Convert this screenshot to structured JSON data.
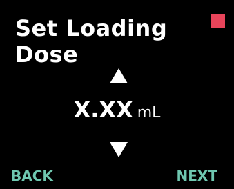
{
  "screen": {
    "title_line1": "Set Loading",
    "title_line2": "Dose",
    "value": "X.XX",
    "unit": "mL",
    "back_label": "BACK",
    "next_label": "NEXT",
    "icons": {
      "increase": "triangle-up-icon",
      "decrease": "triangle-down-icon",
      "status": "status-indicator-square"
    }
  },
  "colors": {
    "background": "#000000",
    "text": "#ffffff",
    "softkey": "#6fc7b0",
    "status_indicator": "#e8445a"
  }
}
